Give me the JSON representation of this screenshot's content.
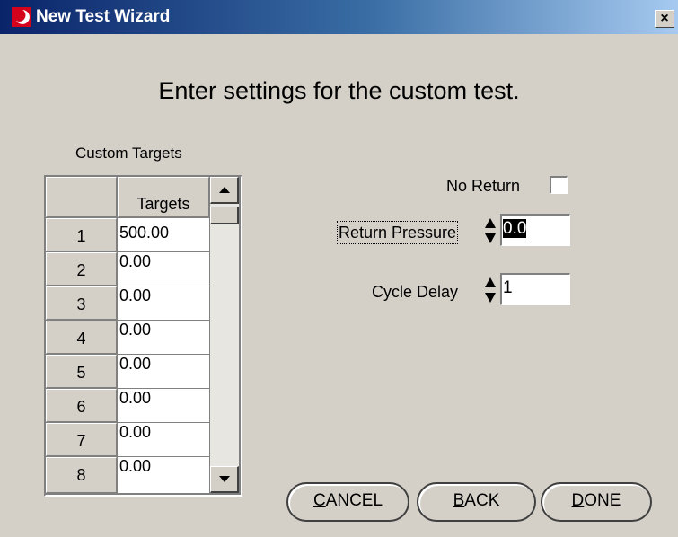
{
  "window": {
    "title": "New Test Wizard",
    "close_label": "×"
  },
  "heading": "Enter settings for the custom test.",
  "targets_grid": {
    "label": "Custom Targets",
    "column_header": "Targets",
    "rows": [
      {
        "num": "1",
        "value": "500.00"
      },
      {
        "num": "2",
        "value": "0.00"
      },
      {
        "num": "3",
        "value": "0.00"
      },
      {
        "num": "4",
        "value": "0.00"
      },
      {
        "num": "5",
        "value": "0.00"
      },
      {
        "num": "6",
        "value": "0.00"
      },
      {
        "num": "7",
        "value": "0.00"
      },
      {
        "num": "8",
        "value": "0.00"
      }
    ]
  },
  "settings": {
    "no_return_label": "No Return",
    "no_return_checked": false,
    "return_pressure_label": "Return Pressure",
    "return_pressure_value": "0.0",
    "cycle_delay_label": "Cycle Delay",
    "cycle_delay_value": "1"
  },
  "buttons": {
    "cancel_mnemonic": "C",
    "cancel_rest": "ANCEL",
    "back_mnemonic": "B",
    "back_rest": "ACK",
    "done_mnemonic": "D",
    "done_rest": "ONE"
  }
}
